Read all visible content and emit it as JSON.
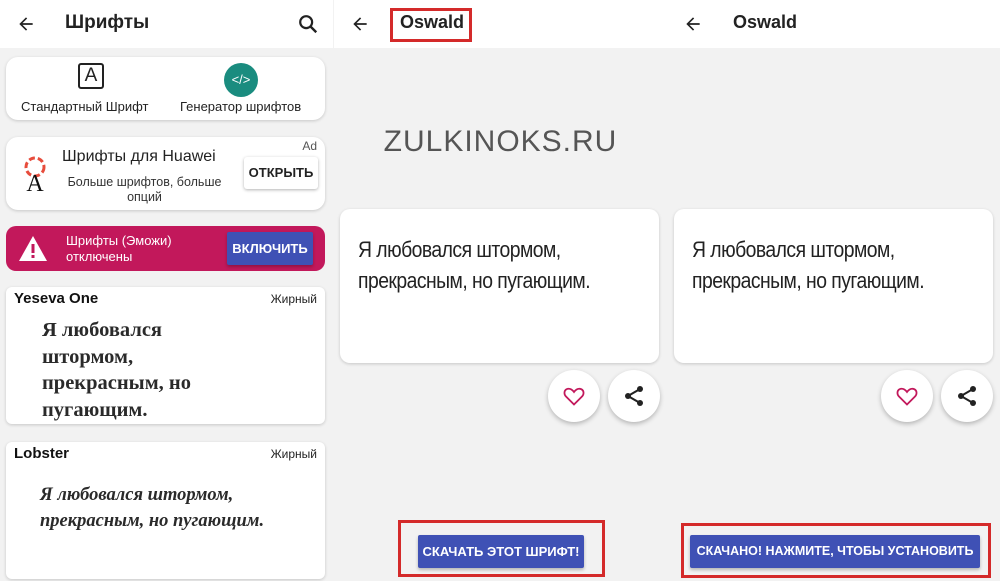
{
  "left": {
    "title": "Шрифты",
    "tools": [
      {
        "label": "Стандартный Шрифт",
        "icon": "font-a-icon"
      },
      {
        "label": "Генератор шрифтов",
        "icon": "code-icon"
      }
    ],
    "ad": {
      "badge": "Ad",
      "title": "Шрифты для Huawei",
      "subtitle": "Больше шрифтов, больше опций",
      "button": "ОТКРЫТЬ"
    },
    "warning": {
      "text": "Шрифты (Эможи) отключены",
      "button": "ВКЛЮЧИТЬ"
    },
    "fonts": [
      {
        "name": "Yeseva One",
        "weight": "Жирный",
        "sample": "Я любовался штормом, прекрасным, но пугающим."
      },
      {
        "name": "Lobster",
        "weight": "Жирный",
        "sample": "Я любовался штормом, прекрасным, но пугающим."
      }
    ]
  },
  "middle": {
    "title": "Oswald",
    "watermark": "ZULKINOKS.RU",
    "sample": "Я любовался штормом, прекрасным, но пугающим.",
    "button": "СКАЧАТЬ ЭТОТ ШРИФТ!"
  },
  "right": {
    "title": "Oswald",
    "sample": "Я любовался штормом, прекрасным, но пугающим.",
    "button": "СКАЧАНО! НАЖМИТЕ, ЧТОБЫ УСТАНОВИТЬ"
  },
  "colors": {
    "accent": "#3f51b5",
    "warning": "#c2185b",
    "highlight": "#d42a2a",
    "teal": "#1a8c7f"
  }
}
